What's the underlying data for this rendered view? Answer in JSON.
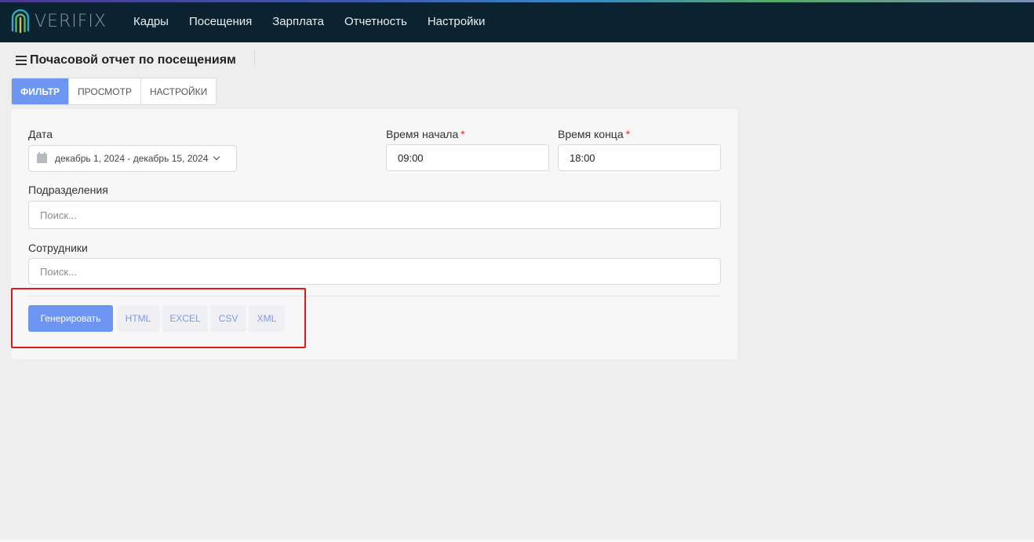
{
  "brand": {
    "name": "VERIFIX"
  },
  "nav": {
    "items": [
      "Кадры",
      "Посещения",
      "Зарплата",
      "Отчетность",
      "Настройки"
    ]
  },
  "page": {
    "title": "Почасовой отчет по посещениям"
  },
  "tabs": [
    "Фильтр",
    "Просмотр",
    "Настройки"
  ],
  "filter": {
    "date_label": "Дата",
    "date_value": "декабрь 1, 2024 - декабрь 15, 2024",
    "start_label": "Время начала",
    "start_value": "09:00",
    "end_label": "Время конца",
    "end_value": "18:00",
    "required_mark": "*",
    "divisions_label": "Подразделения",
    "divisions_placeholder": "Поиск...",
    "employees_label": "Сотрудники",
    "employees_placeholder": "Поиск..."
  },
  "actions": {
    "generate": "Генерировать",
    "html": "HTML",
    "excel": "EXCEL",
    "csv": "CSV",
    "xml": "XML"
  },
  "colors": {
    "navbar": "#0b2330",
    "accent": "#6f95f2",
    "highlight": "#e01818"
  }
}
